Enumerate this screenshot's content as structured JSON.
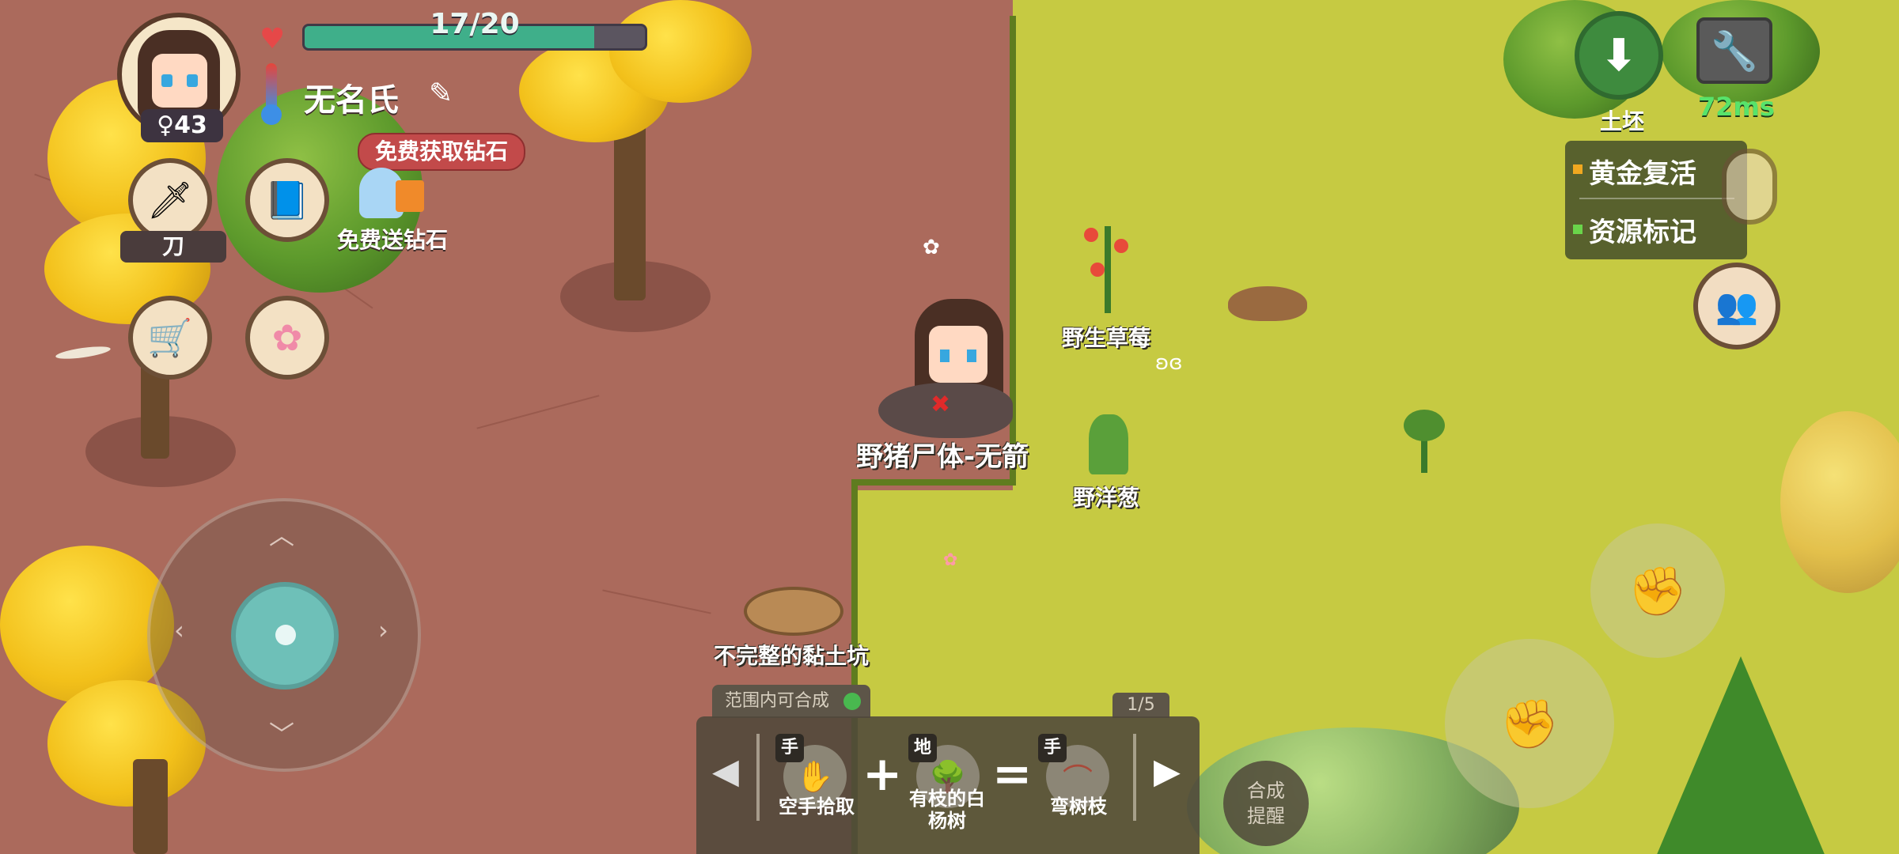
{
  "hud": {
    "hp_text": "17/20",
    "hp_fraction": 0.85,
    "player_name": "无名氏",
    "level": "♀43",
    "promo_pill": "免费获取钻石",
    "weapon_label": "刀",
    "gift_label": "免费送钻石"
  },
  "right_hud": {
    "download_label": "土坯",
    "ping": "72ms",
    "menu": [
      "黄金复活",
      "资源标记"
    ]
  },
  "world": {
    "corpse_label": "野猪尸体-无箭",
    "strawberry_label": "野生草莓",
    "onion_label": "野洋葱",
    "clay_pit_label": "不完整的黏土坑"
  },
  "crafting": {
    "tab_label": "范围内可合成",
    "page": "1/5",
    "slot1_tag": "手",
    "slot1_name": "空手拾取",
    "slot2_tag": "地",
    "slot2_name": "有枝的白杨树",
    "slot3_tag": "手",
    "slot3_name": "弯树枝",
    "merge_label": "合成提醒"
  },
  "colors": {
    "dirt": "#ab6a5c",
    "grass": "#c6ca42",
    "hp_fill": "#3faf8a",
    "promo": "#c24a4a",
    "ping": "#57e36b"
  }
}
